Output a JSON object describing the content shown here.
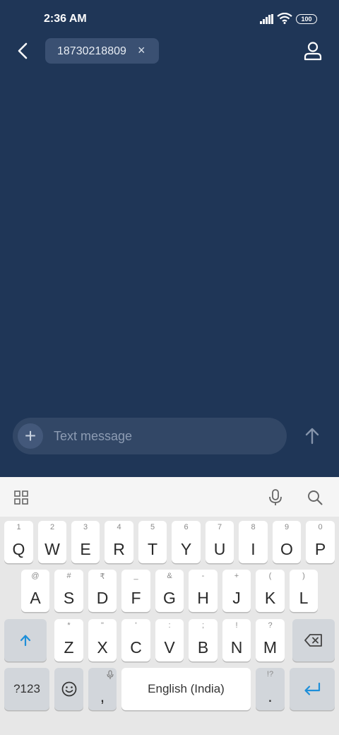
{
  "status_bar": {
    "time": "2:36 AM",
    "battery": "100"
  },
  "header": {
    "recipient": "18730218809",
    "remove_symbol": "×"
  },
  "compose": {
    "placeholder": "Text message",
    "add_symbol": "+"
  },
  "keyboard": {
    "row1": [
      {
        "letter": "Q",
        "hint": "1"
      },
      {
        "letter": "W",
        "hint": "2"
      },
      {
        "letter": "E",
        "hint": "3"
      },
      {
        "letter": "R",
        "hint": "4"
      },
      {
        "letter": "T",
        "hint": "5"
      },
      {
        "letter": "Y",
        "hint": "6"
      },
      {
        "letter": "U",
        "hint": "7"
      },
      {
        "letter": "I",
        "hint": "8"
      },
      {
        "letter": "O",
        "hint": "9"
      },
      {
        "letter": "P",
        "hint": "0"
      }
    ],
    "row2": [
      {
        "letter": "A",
        "hint": "@"
      },
      {
        "letter": "S",
        "hint": "#"
      },
      {
        "letter": "D",
        "hint": "₹"
      },
      {
        "letter": "F",
        "hint": "_"
      },
      {
        "letter": "G",
        "hint": "&"
      },
      {
        "letter": "H",
        "hint": "-"
      },
      {
        "letter": "J",
        "hint": "+"
      },
      {
        "letter": "K",
        "hint": "("
      },
      {
        "letter": "L",
        "hint": ")"
      }
    ],
    "row3": [
      {
        "letter": "Z",
        "hint": "*"
      },
      {
        "letter": "X",
        "hint": "\""
      },
      {
        "letter": "C",
        "hint": "'"
      },
      {
        "letter": "V",
        "hint": ":"
      },
      {
        "letter": "B",
        "hint": ";"
      },
      {
        "letter": "N",
        "hint": "!"
      },
      {
        "letter": "M",
        "hint": "?"
      }
    ],
    "symbols_label": "?123",
    "comma_label": ",",
    "space_label": "English (India)",
    "period_label": ".",
    "period_hint": "!?"
  },
  "colors": {
    "background": "#1f3657",
    "accent": "#1e8fd9"
  }
}
